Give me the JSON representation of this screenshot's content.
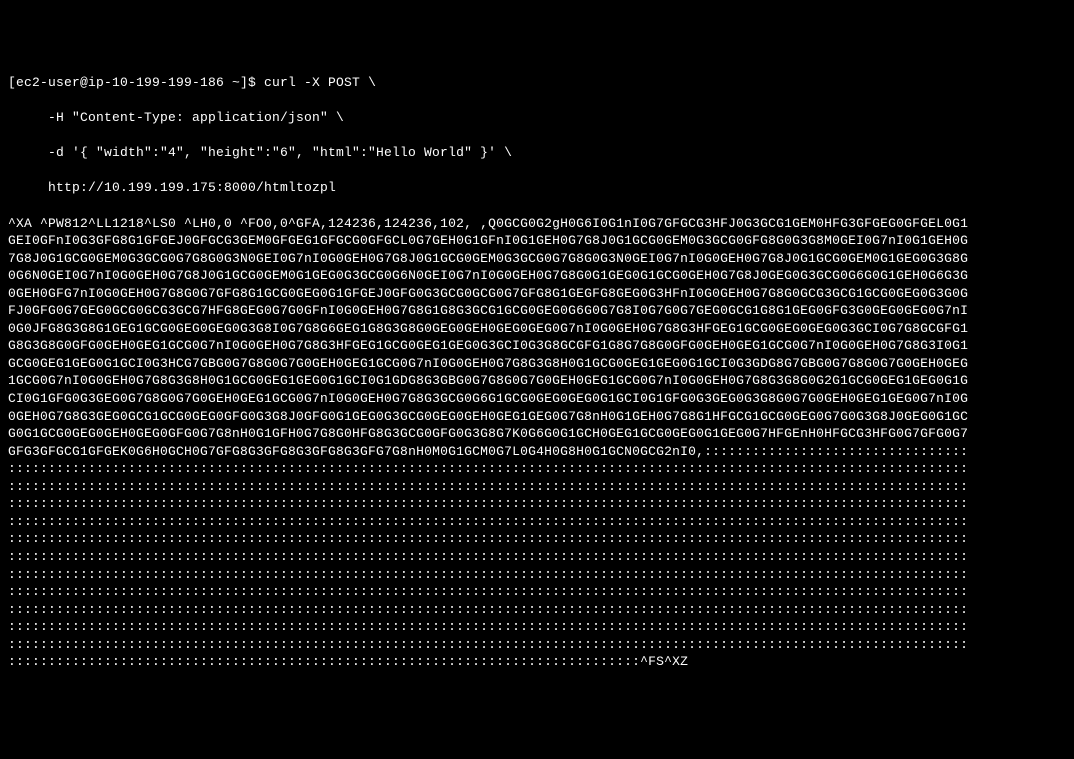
{
  "terminal": {
    "prompt": "[ec2-user@ip-10-199-199-186 ~]$ ",
    "cmd_line1": "curl -X POST \\",
    "cmd_line2": "-H \"Content-Type: application/json\" \\",
    "cmd_line3": "-d '{ \"width\":\"4\", \"height\":\"6\", \"html\":\"Hello World\" }' \\",
    "cmd_line4": "http://10.199.199.175:8000/htmltozpl",
    "output_lines": [
      "^XA ^PW812^LL1218^LS0 ^LH0,0 ^FO0,0^GFA,124236,124236,102, ,Q0GCG0G2gH0G6I0G1nI0G7GFGCG3HFJ0G3GCG1GEM0HFG3GFGEG0GFGEL0G1",
      "GEI0GFnI0G3GFG8G1GFGEJ0GFGCG3GEM0GFGEG1GFGCG0GFGCL0G7GEH0G1GFnI0G1GEH0G7G8J0G1GCG0GEM0G3GCG0GFG8G0G3G8M0GEI0G7nI0G1GEH0G",
      "7G8J0G1GCG0GEM0G3GCG0G7G8G0G3N0GEI0G7nI0G0GEH0G7G8J0G1GCG0GEM0G3GCG0G7G8G0G3N0GEI0G7nI0G0GEH0G7G8J0G1GCG0GEM0G1GEG0G3G8G",
      "0G6N0GEI0G7nI0G0GEH0G7G8J0G1GCG0GEM0G1GEG0G3GCG0G6N0GEI0G7nI0G0GEH0G7G8G0G1GEG0G1GCG0GEH0G7G8J0GEG0G3GCG0G6G0G1GEH0G6G3G",
      "0GEH0GFG7nI0G0GEH0G7G8G0G7GFG8G1GCG0GEG0G1GFGEJ0GFG0G3GCG0GCG0G7GFG8G1GEGFG8GEG0G3HFnI0G0GEH0G7G8G0GCG3GCG1GCG0GEG0G3G0G",
      "FJ0GFG0G7GEG0GCG0GCG3GCG7HFG8GEG0G7G0GFnI0G0GEH0G7G8G1G8G3GCG1GCG0GEG0G6G0G7G8I0G7G0G7GEG0GCG1G8G1GEG0GFG3G0GEG0GEG0G7nI",
      "0G0JFG8G3G8G1GEG1GCG0GEG0GEG0G3G8I0G7G8G6GEG1G8G3G8G0GEG0GEH0GEG0GEG0G7nI0G0GEH0G7G8G3HFGEG1GCG0GEG0GEG0G3GCI0G7G8GCGFG1",
      "G8G3G8G0GFG0GEH0GEG1GCG0G7nI0G0GEH0G7G8G3HFGEG1GCG0GEG1GEG0G3GCI0G3G8GCGFG1G8G7G8G0GFG0GEH0GEG1GCG0G7nI0G0GEH0G7G8G3I0G1",
      "GCG0GEG1GEG0G1GCI0G3HCG7GBG0G7G8G0G7G0GEH0GEG1GCG0G7nI0G0GEH0G7G8G3G8H0G1GCG0GEG1GEG0G1GCI0G3GDG8G7GBG0G7G8G0G7G0GEH0GEG",
      "1GCG0G7nI0G0GEH0G7G8G3G8H0G1GCG0GEG1GEG0G1GCI0G1GDG8G3GBG0G7G8G0G7G0GEH0GEG1GCG0G7nI0G0GEH0G7G8G3G8G0G2G1GCG0GEG1GEG0G1G",
      "CI0G1GFG0G3GEG0G7G8G0G7G0GEH0GEG1GCG0G7nI0G0GEH0G7G8G3GCG0G6G1GCG0GEG0GEG0G1GCI0G1GFG0G3GEG0G3G8G0G7G0GEH0GEG1GEG0G7nI0G",
      "0GEH0G7G8G3GEG0GCG1GCG0GEG0GFG0G3G8J0GFG0G1GEG0G3GCG0GEG0GEH0GEG1GEG0G7G8nH0G1GEH0G7G8G1HFGCG1GCG0GEG0G7G0G3G8J0GEG0G1GC",
      "G0G1GCG0GEG0GEH0GEG0GFG0G7G8nH0G1GFH0G7G8G0HFG8G3GCG0GFG0G3G8G7K0G6G0G1GCH0GEG1GCG0GEG0G1GEG0G7HFGEnH0HFGCG3HFG0G7GFG0G7",
      "GFG3GFGCG1GFGEK0G6H0GCH0G7GFG8G3GFG8G3GFG8G3GFG7G8nH0M0G1GCM0G7L0G4H0G8H0G1GCN0GCG2nI0,:::::::::::::::::::::::::::::::::",
      "::::::::::::::::::::::::::::::::::::::::::::::::::::::::::::::::::::::::::::::::::::::::::::::::::::::::::::::::::::::::",
      "::::::::::::::::::::::::::::::::::::::::::::::::::::::::::::::::::::::::::::::::::::::::::::::::::::::::::::::::::::::::",
      "::::::::::::::::::::::::::::::::::::::::::::::::::::::::::::::::::::::::::::::::::::::::::::::::::::::::::::::::::::::::",
      "::::::::::::::::::::::::::::::::::::::::::::::::::::::::::::::::::::::::::::::::::::::::::::::::::::::::::::::::::::::::",
      "::::::::::::::::::::::::::::::::::::::::::::::::::::::::::::::::::::::::::::::::::::::::::::::::::::::::::::::::::::::::",
      "::::::::::::::::::::::::::::::::::::::::::::::::::::::::::::::::::::::::::::::::::::::::::::::::::::::::::::::::::::::::",
      "::::::::::::::::::::::::::::::::::::::::::::::::::::::::::::::::::::::::::::::::::::::::::::::::::::::::::::::::::::::::",
      "::::::::::::::::::::::::::::::::::::::::::::::::::::::::::::::::::::::::::::::::::::::::::::::::::::::::::::::::::::::::",
      "::::::::::::::::::::::::::::::::::::::::::::::::::::::::::::::::::::::::::::::::::::::::::::::::::::::::::::::::::::::::",
      "::::::::::::::::::::::::::::::::::::::::::::::::::::::::::::::::::::::::::::::::::::::::::::::::::::::::::::::::::::::::",
      "::::::::::::::::::::::::::::::::::::::::::::::::::::::::::::::::::::::::::::::::::::::::::::::::::::::::::::::::::::::::",
      ":::::::::::::::::::::::::::::::::::::::::::::::::::::::::::::::::::::::::::::::^FS^XZ"
    ]
  }
}
